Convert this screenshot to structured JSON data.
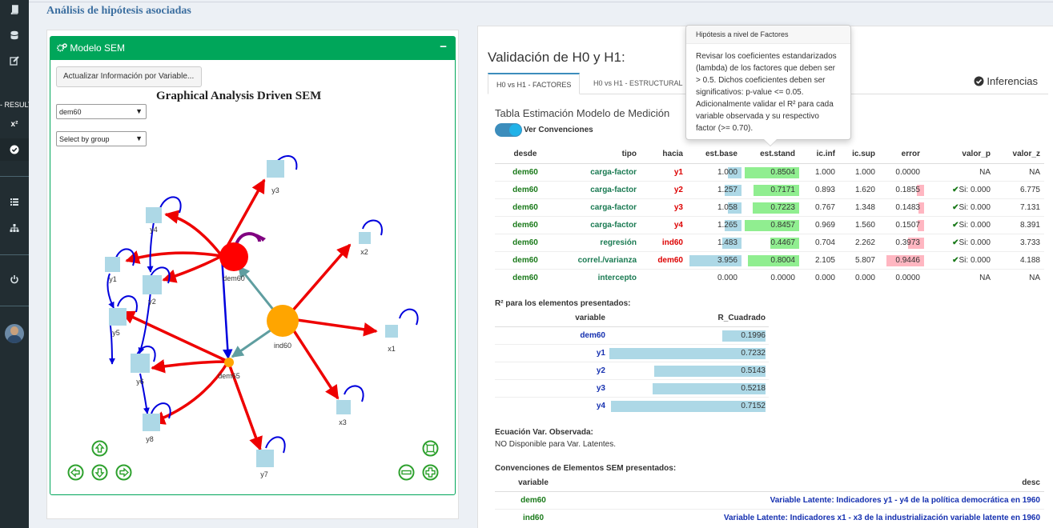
{
  "sidebar": {
    "result_label": "- RESULT",
    "chi_label": "x²",
    "icons": [
      "book-icon",
      "database-icon",
      "edit-icon",
      "chi-square-icon",
      "check-circle-icon",
      "list-icon",
      "sitemap-icon",
      "power-icon"
    ]
  },
  "page": {
    "title": "Análisis de hipótesis asociadas"
  },
  "left_panel": {
    "box_title": "Modelo SEM",
    "update_button": "Actualizar Información por Variable...",
    "graph_title": "Graphical Analysis Driven SEM",
    "node_select": "dem60",
    "group_select": "Select by group"
  },
  "graph": {
    "nodes": [
      {
        "id": "dem60",
        "label": "dem60",
        "type": "latent"
      },
      {
        "id": "ind60",
        "label": "ind60",
        "type": "latent"
      },
      {
        "id": "dem65",
        "label": "dem65",
        "type": "latent"
      },
      {
        "id": "y1",
        "label": "y1",
        "type": "observed"
      },
      {
        "id": "y2",
        "label": "y2",
        "type": "observed"
      },
      {
        "id": "y3",
        "label": "y3",
        "type": "observed"
      },
      {
        "id": "y4",
        "label": "y4",
        "type": "observed"
      },
      {
        "id": "y5",
        "label": "y5",
        "type": "observed"
      },
      {
        "id": "y6",
        "label": "y6",
        "type": "observed"
      },
      {
        "id": "y7",
        "label": "y7",
        "type": "observed"
      },
      {
        "id": "y8",
        "label": "y8",
        "type": "observed"
      },
      {
        "id": "x1",
        "label": "x1",
        "type": "observed"
      },
      {
        "id": "x2",
        "label": "x2",
        "type": "observed"
      },
      {
        "id": "x3",
        "label": "x3",
        "type": "observed"
      }
    ]
  },
  "right_panel": {
    "title": "Validación de H0 y H1:",
    "tabs": [
      "H0 vs H1 - FACTORES",
      "H0 vs H1 - ESTRUCTURAL"
    ],
    "right_tab": "Inferencias",
    "section_title": "Tabla Estimación Modelo de Medición",
    "toggle_label": "Ver Convenciones"
  },
  "measurement_table": {
    "headers": [
      "desde",
      "tipo",
      "hacia",
      "est.base",
      "est.stand",
      "ic.inf",
      "ic.sup",
      "error",
      "valor_p",
      "valor_z"
    ],
    "rows": [
      {
        "desde": "dem60",
        "tipo": "carga-factor",
        "hacia": "y1",
        "est_base": "1.000",
        "est_stand": "0.8504",
        "ic_inf": "1.000",
        "ic_sup": "1.000",
        "error": "0.0000",
        "valor_p": "NA",
        "valor_z": "NA",
        "base_v": 1.0,
        "stand_v": 0.8504,
        "err_v": 0.0
      },
      {
        "desde": "dem60",
        "tipo": "carga-factor",
        "hacia": "y2",
        "est_base": "1.257",
        "est_stand": "0.7171",
        "ic_inf": "0.893",
        "ic_sup": "1.620",
        "error": "0.1855",
        "valor_p": "Si: 0.000",
        "valor_z": "6.775",
        "base_v": 1.257,
        "stand_v": 0.7171,
        "err_v": 0.1855
      },
      {
        "desde": "dem60",
        "tipo": "carga-factor",
        "hacia": "y3",
        "est_base": "1.058",
        "est_stand": "0.7223",
        "ic_inf": "0.767",
        "ic_sup": "1.348",
        "error": "0.1483",
        "valor_p": "Si: 0.000",
        "valor_z": "7.131",
        "base_v": 1.058,
        "stand_v": 0.7223,
        "err_v": 0.1483
      },
      {
        "desde": "dem60",
        "tipo": "carga-factor",
        "hacia": "y4",
        "est_base": "1.265",
        "est_stand": "0.8457",
        "ic_inf": "0.969",
        "ic_sup": "1.560",
        "error": "0.1507",
        "valor_p": "Si: 0.000",
        "valor_z": "8.391",
        "base_v": 1.265,
        "stand_v": 0.8457,
        "err_v": 0.1507
      },
      {
        "desde": "dem60",
        "tipo": "regresión",
        "hacia": "ind60",
        "est_base": "1.483",
        "est_stand": "0.4467",
        "ic_inf": "0.704",
        "ic_sup": "2.262",
        "error": "0.3973",
        "valor_p": "Si: 0.000",
        "valor_z": "3.733",
        "base_v": 1.483,
        "stand_v": 0.4467,
        "err_v": 0.3973
      },
      {
        "desde": "dem60",
        "tipo": "correl./varianza",
        "hacia": "dem60",
        "est_base": "3.956",
        "est_stand": "0.8004",
        "ic_inf": "2.105",
        "ic_sup": "5.807",
        "error": "0.9446",
        "valor_p": "Si: 0.000",
        "valor_z": "4.188",
        "base_v": 3.956,
        "stand_v": 0.8004,
        "err_v": 0.9446
      },
      {
        "desde": "dem60",
        "tipo": "intercepto",
        "hacia": "",
        "est_base": "0.000",
        "est_stand": "0.0000",
        "ic_inf": "0.000",
        "ic_sup": "0.000",
        "error": "0.0000",
        "valor_p": "NA",
        "valor_z": "NA",
        "base_v": 0.0,
        "stand_v": 0.0,
        "err_v": 0.0
      }
    ]
  },
  "r2": {
    "title": "R² para los elementos presentados:",
    "headers": [
      "variable",
      "R_Cuadrado"
    ],
    "rows": [
      {
        "variable": "dem60",
        "value": "0.1996",
        "v": 0.1996
      },
      {
        "variable": "y1",
        "value": "0.7232",
        "v": 0.7232
      },
      {
        "variable": "y2",
        "value": "0.5143",
        "v": 0.5143
      },
      {
        "variable": "y3",
        "value": "0.5218",
        "v": 0.5218
      },
      {
        "variable": "y4",
        "value": "0.7152",
        "v": 0.7152
      }
    ]
  },
  "equation": {
    "title": "Ecuación Var. Observada:",
    "text": "NO Disponible para Var. Latentes."
  },
  "conventions": {
    "title": "Convenciones de Elementos SEM presentados:",
    "headers": [
      "variable",
      "desc"
    ],
    "rows": [
      {
        "variable": "dem60",
        "desc": "Variable Latente: Indicadores y1 - y4 de la política democrática en 1960"
      },
      {
        "variable": "ind60",
        "desc": "Variable Latente: Indicadores x1 - x3 de la industrialización variable latente en 1960"
      }
    ]
  },
  "tooltip": {
    "title": "Hipótesis a nivel de Factores",
    "body": "Revisar los coeficientes estandarizados (lambda) de los factores que deben ser > 0.5. Dichos coeficientes deben ser significativos: p-value <= 0.05. Adicionalmente validar el R² para cada variable observada y su respectivo factor (>= 0.70)."
  },
  "colors": {
    "primary": "#00a65a",
    "dem60_node": "#ff0000",
    "ind60_node": "#ffa500",
    "observed_node": "#add8e6",
    "loading_edge": "#ff0000",
    "variance_edge": "#0000ff",
    "regression_edge": "#5f9ea0"
  }
}
